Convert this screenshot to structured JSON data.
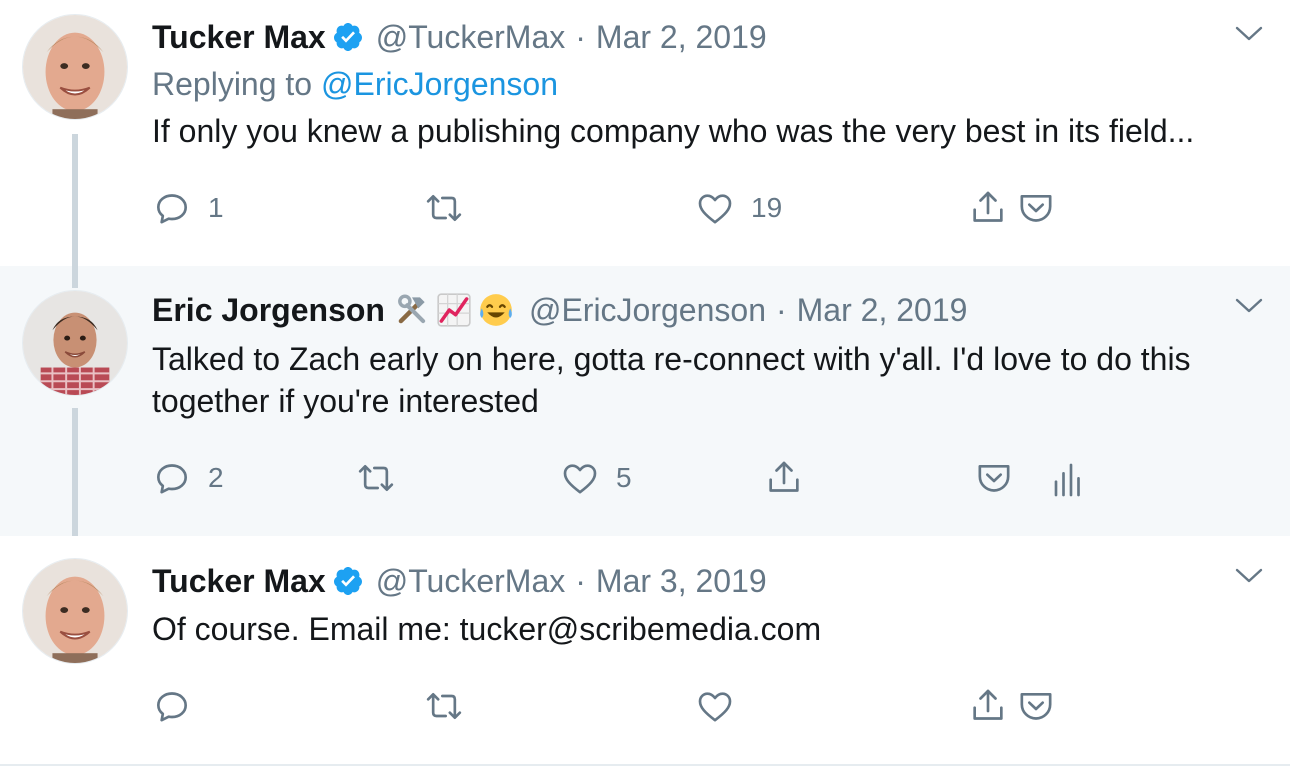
{
  "colors": {
    "accent": "#1b95e0",
    "muted": "#657786",
    "text": "#14171a",
    "highlight_bg": "#f5f8fa",
    "thread_line": "#ccd6dd"
  },
  "tweets": [
    {
      "name": "Tucker Max",
      "verified": true,
      "handle": "@TuckerMax",
      "separator": "·",
      "date": "Mar 2, 2019",
      "replying_label": "Replying to",
      "replying_handle": "@EricJorgenson",
      "text": "If only you knew a publishing company who was the very best in its field...",
      "reply_count": "1",
      "retweet_count": "",
      "like_count": "19"
    },
    {
      "name": "Eric Jorgenson",
      "emojis": [
        "hammer-and-wrench-emoji",
        "chart-increasing-emoji",
        "tears-of-joy-emoji"
      ],
      "handle": "@EricJorgenson",
      "separator": "·",
      "date": "Mar 2, 2019",
      "text": "Talked to Zach early on here, gotta re-connect with y'all. I'd love to do this together if you're interested",
      "reply_count": "2",
      "retweet_count": "",
      "like_count": "5"
    },
    {
      "name": "Tucker Max",
      "verified": true,
      "handle": "@TuckerMax",
      "separator": "·",
      "date": "Mar 3, 2019",
      "text": "Of course. Email me: tucker@scribemedia.com",
      "reply_count": "",
      "retweet_count": "",
      "like_count": ""
    }
  ],
  "icons": [
    "reply-icon",
    "retweet-icon",
    "like-icon",
    "share-icon",
    "pocket-icon",
    "analytics-icon",
    "chevron-down-icon",
    "verified-icon"
  ]
}
